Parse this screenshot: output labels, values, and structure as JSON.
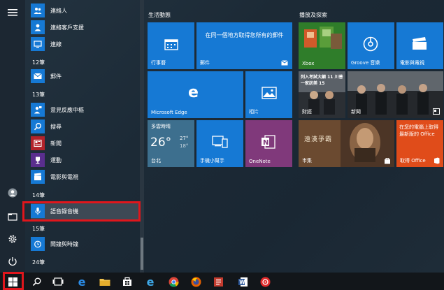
{
  "applist": {
    "items": [
      {
        "label": "連絡人"
      },
      {
        "label": "連絡客戶支援"
      },
      {
        "label": "連線"
      },
      {
        "label": "郵件"
      },
      {
        "label": "意見反應中樞"
      },
      {
        "label": "搜尋"
      },
      {
        "label": "新聞"
      },
      {
        "label": "運動"
      },
      {
        "label": "電影與電視"
      },
      {
        "label": "語音錄音機"
      },
      {
        "label": "鬧鐘與時鐘"
      }
    ],
    "headers": [
      "12筆",
      "13筆",
      "14筆",
      "15筆",
      "24筆"
    ]
  },
  "groups": {
    "left": "生活動態",
    "right": "播放及探索"
  },
  "tiles": {
    "calendar": "行事曆",
    "mail_text": "在同一個地方取得您所有的郵件",
    "mail": "郵件",
    "edge": "Microsoft Edge",
    "photos": "相片",
    "weather_title": "多雲時晴",
    "weather_temp": "26°",
    "weather_high": "27°",
    "weather_low": "18°",
    "weather_city": "台北",
    "phone": "手機小幫手",
    "onenote": "OneNote",
    "xbox": "Xbox",
    "groove": "Groove 音樂",
    "movies": "電影與電視",
    "finance": "財經",
    "finance_headline": "列入考試大綱 11 川普一家訪美 15",
    "news": "新聞",
    "store": "市集",
    "store_banner": "遠漢爭霸",
    "office_text": "在您的電腦上取得最新版的 Office",
    "office": "取得 Office"
  },
  "colors": {
    "accent": "#1679d4",
    "highlight": "#e0161c",
    "weather": "#3d6f8e",
    "onenote": "#80397b",
    "office": "#e04c1a"
  }
}
